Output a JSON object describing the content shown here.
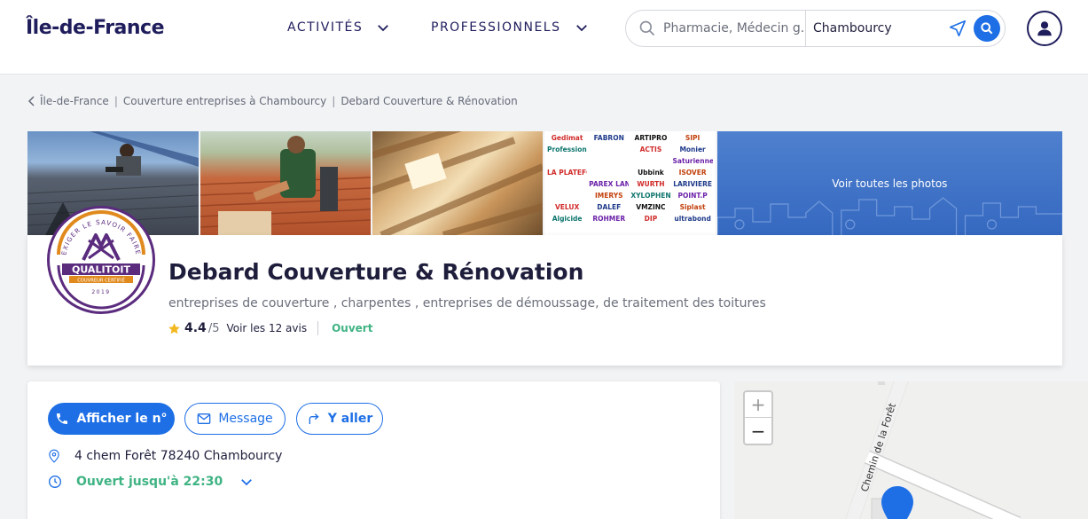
{
  "header": {
    "logo": "Île-de-France",
    "nav": [
      {
        "label": "ACTIVITÉS"
      },
      {
        "label": "PROFESSIONNELS"
      }
    ],
    "search": {
      "query_placeholder": "Pharmacie, Médecin g...",
      "location_value": "Chambourcy"
    }
  },
  "breadcrumb": [
    {
      "label": "Île-de-France"
    },
    {
      "label": "Couverture entreprises à Chambourcy"
    },
    {
      "label": "Debard Couverture & Rénovation"
    }
  ],
  "photos": {
    "see_all_label": "Voir toutes les photos",
    "brand_logos": [
      "Gedimat",
      "FABRON",
      "ARTIPRO",
      "SIPI",
      "Professionnels d'Angers",
      "",
      "ACTIS",
      "Monier",
      "",
      "",
      "",
      "Saturienne",
      "LA PLATEFORME",
      "",
      "Ubbink",
      "ISOVER",
      "",
      "PAREX LANKO",
      "WURTH",
      "LARIVIERE",
      "",
      "IMERYS",
      "XYLOPHENE",
      "POINT.P",
      "VELUX",
      "DALEF",
      "VMZINC",
      "Siplast",
      "Algicide",
      "ROHMER",
      "DIP",
      "ultrabond"
    ],
    "badge_top_text": "EXIGER LE SAVOIR FAIRE",
    "badge_brand": "QUALITOIT",
    "badge_sub": "COUVREUR CERTIFIÉ",
    "badge_year": "2019"
  },
  "company": {
    "name": "Debard Couverture & Rénovation",
    "activities": "entreprises de couverture , charpentes , entreprises de démoussage, de traitement des toitures",
    "rating": "4.4",
    "rating_max": "/5",
    "reviews_label": "Voir les 12 avis",
    "status": "Ouvert"
  },
  "contact": {
    "call_label": "Afficher le n°",
    "message_label": "Message",
    "directions_label": "Y aller",
    "address": "4 chem Forêt 78240 Chambourcy",
    "hours": "Ouvert jusqu'à 22:30"
  },
  "map": {
    "street_label": "Chemin de la Forêt",
    "zoom_in": "+",
    "zoom_out": "−"
  },
  "colors": {
    "brand_navy": "#1f1d5c",
    "primary_blue": "#1e6fe6",
    "open_green": "#3fb383"
  }
}
